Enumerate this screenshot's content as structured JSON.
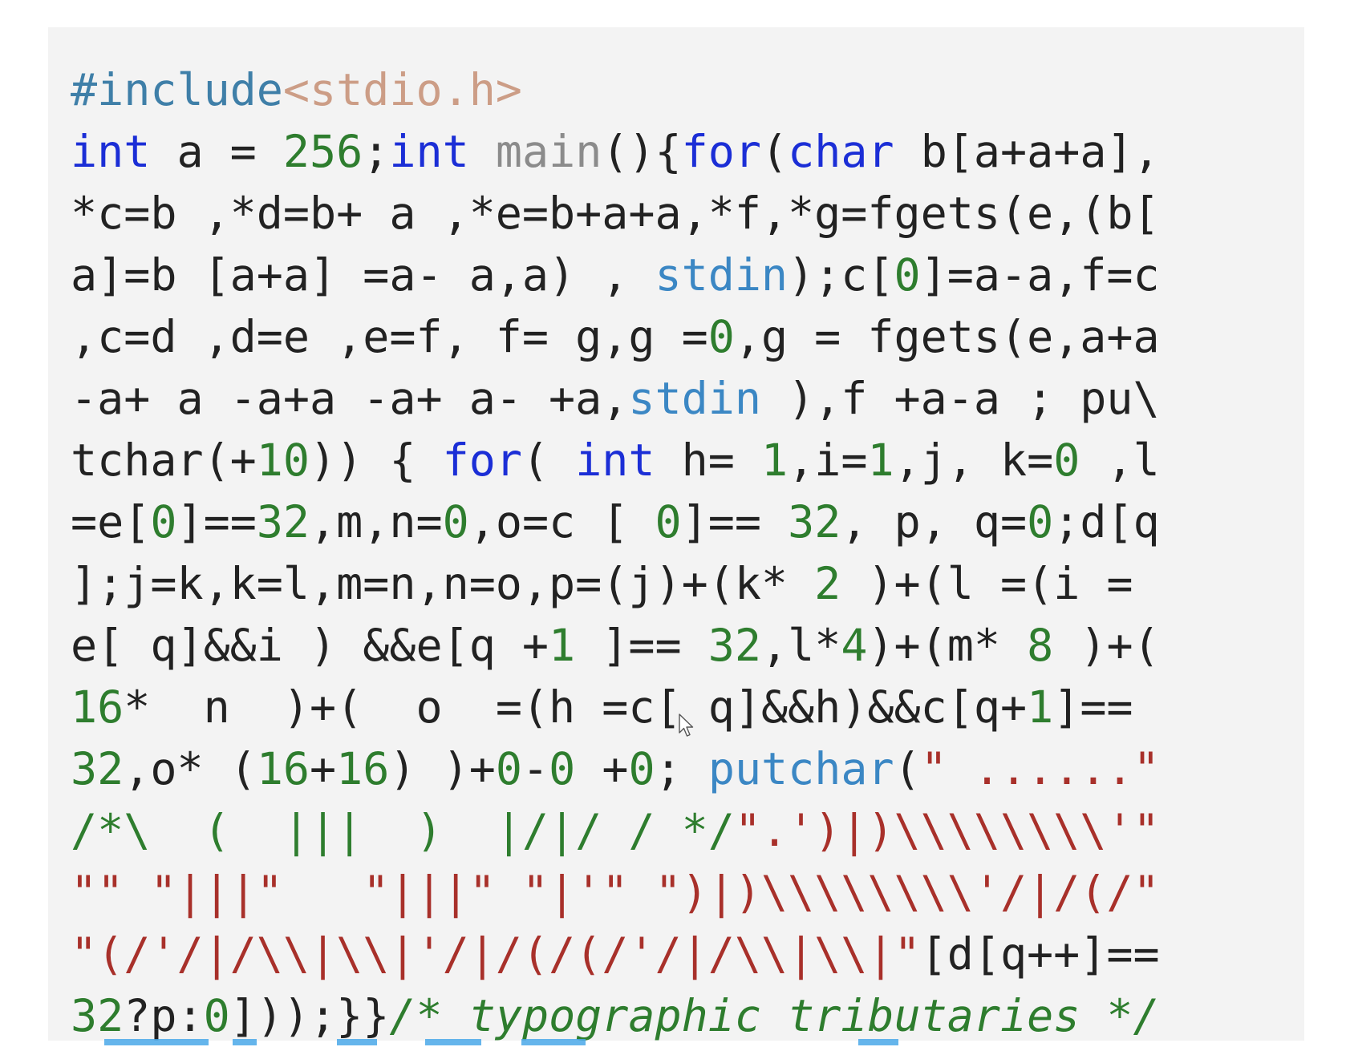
{
  "code": {
    "lines": [
      [
        {
          "t": "#include",
          "c": "pp"
        },
        {
          "t": "<stdio.h>",
          "c": "inc"
        }
      ],
      [
        {
          "t": "int",
          "c": "kw"
        },
        {
          "t": " a = ",
          "c": ""
        },
        {
          "t": "256",
          "c": "num"
        },
        {
          "t": ";",
          "c": ""
        },
        {
          "t": "int",
          "c": "kw"
        },
        {
          "t": " ",
          "c": ""
        },
        {
          "t": "main",
          "c": "fn"
        },
        {
          "t": "(){",
          "c": ""
        },
        {
          "t": "for",
          "c": "kw"
        },
        {
          "t": "(",
          "c": ""
        },
        {
          "t": "char",
          "c": "kw"
        },
        {
          "t": " b[a+a+a],",
          "c": ""
        }
      ],
      [
        {
          "t": "*c=b ,*d=b+ a ,*e=b+a+a,*f,*g=fgets(e,(b[",
          "c": ""
        }
      ],
      [
        {
          "t": "a]=b [a+a] =a- a,a) , ",
          "c": ""
        },
        {
          "t": "stdin",
          "c": "lib"
        },
        {
          "t": ");c[",
          "c": ""
        },
        {
          "t": "0",
          "c": "num"
        },
        {
          "t": "]=a-a,f=c",
          "c": ""
        }
      ],
      [
        {
          "t": ",c=d ,d=e ,e=f, f= g,g =",
          "c": ""
        },
        {
          "t": "0",
          "c": "num"
        },
        {
          "t": ",g = fgets(e,a+a",
          "c": ""
        }
      ],
      [
        {
          "t": "-a+ a -a+a -a+ a- +a,",
          "c": ""
        },
        {
          "t": "stdin",
          "c": "lib"
        },
        {
          "t": " ),f +a-a ; pu\\",
          "c": ""
        }
      ],
      [
        {
          "t": "tchar(+",
          "c": ""
        },
        {
          "t": "10",
          "c": "num"
        },
        {
          "t": ")) { ",
          "c": ""
        },
        {
          "t": "for",
          "c": "kw"
        },
        {
          "t": "( ",
          "c": ""
        },
        {
          "t": "int",
          "c": "kw"
        },
        {
          "t": " h= ",
          "c": ""
        },
        {
          "t": "1",
          "c": "num"
        },
        {
          "t": ",i=",
          "c": ""
        },
        {
          "t": "1",
          "c": "num"
        },
        {
          "t": ",j, k=",
          "c": ""
        },
        {
          "t": "0",
          "c": "num"
        },
        {
          "t": " ,l",
          "c": ""
        }
      ],
      [
        {
          "t": "=e[",
          "c": ""
        },
        {
          "t": "0",
          "c": "num"
        },
        {
          "t": "]==",
          "c": ""
        },
        {
          "t": "32",
          "c": "num"
        },
        {
          "t": ",m,n=",
          "c": ""
        },
        {
          "t": "0",
          "c": "num"
        },
        {
          "t": ",o=c [ ",
          "c": ""
        },
        {
          "t": "0",
          "c": "num"
        },
        {
          "t": "]== ",
          "c": ""
        },
        {
          "t": "32",
          "c": "num"
        },
        {
          "t": ", p, q=",
          "c": ""
        },
        {
          "t": "0",
          "c": "num"
        },
        {
          "t": ";d[q",
          "c": ""
        }
      ],
      [
        {
          "t": "];j=k,k=l,m=n,n=o,p=(j)+(k* ",
          "c": ""
        },
        {
          "t": "2",
          "c": "num"
        },
        {
          "t": " )+(l =(i =",
          "c": ""
        }
      ],
      [
        {
          "t": "e[ q]&&i ) &&e[q +",
          "c": ""
        },
        {
          "t": "1",
          "c": "num"
        },
        {
          "t": " ]== ",
          "c": ""
        },
        {
          "t": "32",
          "c": "num"
        },
        {
          "t": ",l*",
          "c": ""
        },
        {
          "t": "4",
          "c": "num"
        },
        {
          "t": ")+(m* ",
          "c": ""
        },
        {
          "t": "8",
          "c": "num"
        },
        {
          "t": " )+(",
          "c": ""
        }
      ],
      [
        {
          "t": "16",
          "c": "num"
        },
        {
          "t": "*  n  )+(  o  =(h =c[ q]&&h)&&c[q+",
          "c": ""
        },
        {
          "t": "1",
          "c": "num"
        },
        {
          "t": "]==",
          "c": ""
        }
      ],
      [
        {
          "t": "32",
          "c": "num"
        },
        {
          "t": ",o* (",
          "c": ""
        },
        {
          "t": "16",
          "c": "num"
        },
        {
          "t": "+",
          "c": ""
        },
        {
          "t": "16",
          "c": "num"
        },
        {
          "t": ") )+",
          "c": ""
        },
        {
          "t": "0",
          "c": "num"
        },
        {
          "t": "-",
          "c": ""
        },
        {
          "t": "0",
          "c": "num"
        },
        {
          "t": " +",
          "c": ""
        },
        {
          "t": "0",
          "c": "num"
        },
        {
          "t": "; ",
          "c": ""
        },
        {
          "t": "putchar",
          "c": "lib"
        },
        {
          "t": "(",
          "c": ""
        },
        {
          "t": "\" ......\"",
          "c": "str"
        }
      ],
      [
        {
          "t": "/*\\  (  |||  )  |/|/ / */",
          "c": "cmt"
        },
        {
          "t": "\".')|)\\\\\\\\\\\\\\\\'\"",
          "c": "str"
        }
      ],
      [
        {
          "t": "\"\" \"|||\"   \"|||\" \"|'\" \")|)\\\\\\\\\\\\\\\\'/|/(/\"",
          "c": "str"
        }
      ],
      [
        {
          "t": "\"(/'/|/\\\\|\\\\|'/|/(/(/'/|/\\\\|\\\\|\"",
          "c": "str"
        },
        {
          "t": "[d[q++]==",
          "c": ""
        }
      ],
      [
        {
          "t": "32",
          "c": "num"
        },
        {
          "t": "?p:",
          "c": ""
        },
        {
          "t": "0",
          "c": "num"
        },
        {
          "t": "]));}}",
          "c": ""
        },
        {
          "t": "/* typographic tributaries */",
          "c": "cmti"
        }
      ]
    ]
  },
  "icons": {
    "cursor": "mouse-pointer-icon"
  },
  "colors": {
    "panel_bg": "#f3f3f3",
    "keyword": "#1b2ed6",
    "library": "#3b87c4",
    "number": "#2e7d2e",
    "string": "#a8302a",
    "comment": "#2e7d2e",
    "preprocessor": "#3f7fa8",
    "include_path": "#cc9d86",
    "function_name": "#8b8b8b",
    "plain": "#222222"
  }
}
